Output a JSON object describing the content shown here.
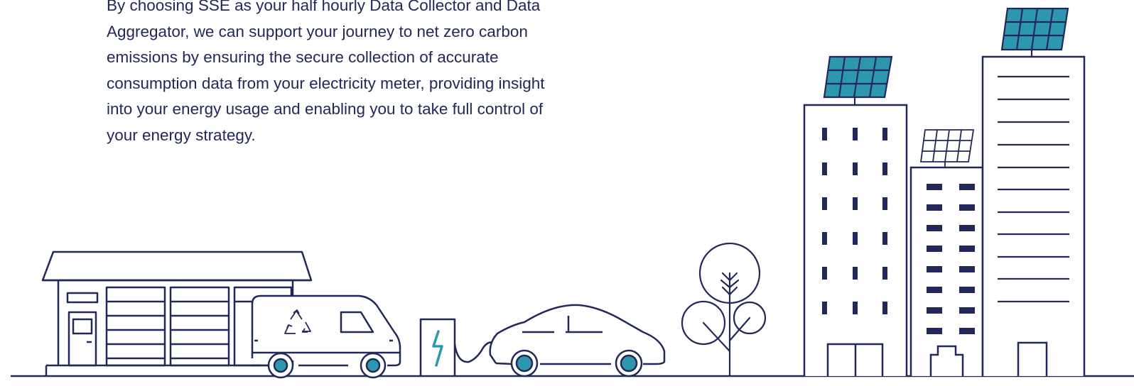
{
  "intro": {
    "paragraph": "By choosing SSE as your half hourly Data Collector and Data Aggregator, we can support your journey to net zero carbon emissions by ensuring the secure collection of accurate consumption data from your electricity meter, providing insight into your energy usage and enabling you to take full control of your energy strategy."
  },
  "illustration": {
    "colors": {
      "outline": "#23285a",
      "accent": "#2d98ad",
      "background": "#ffffff"
    },
    "elements": [
      "shop-building",
      "delivery-van",
      "recycle-icon",
      "ev-charging-station",
      "lightning-bolt-icon",
      "electric-car",
      "trees",
      "office-building-with-solar-panel",
      "small-building-with-solar-panel",
      "tall-building-with-solar-panel"
    ]
  }
}
